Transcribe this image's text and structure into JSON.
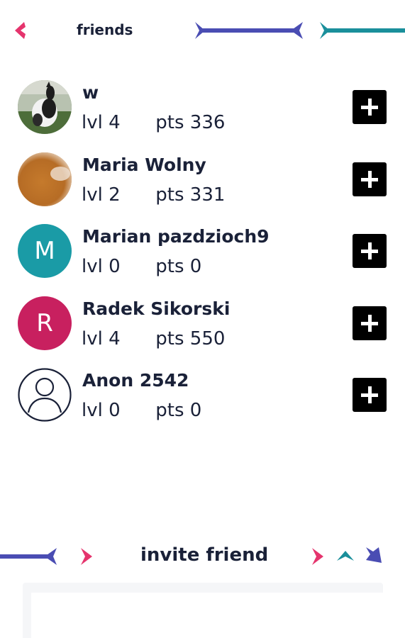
{
  "header": {
    "title": "friends",
    "back_icon": "chevron-left-icon"
  },
  "colors": {
    "accent_pink": "#e5346d",
    "accent_indigo": "#4a4db3",
    "accent_teal": "#1a8f9b",
    "text_dark": "#1a2138"
  },
  "friends": [
    {
      "name": "w",
      "level_label": "lvl 4",
      "points_label": "pts 336",
      "avatar": "photo-cat",
      "add_icon": "plus-icon"
    },
    {
      "name": "Maria Wolny",
      "level_label": "lvl 2",
      "points_label": "pts 331",
      "avatar": "photo-amber",
      "add_icon": "plus-icon"
    },
    {
      "name": "Marian pazdzioch9",
      "level_label": "lvl 0",
      "points_label": "pts 0",
      "avatar": "initial",
      "avatar_initial": "M",
      "avatar_color": "#1a9ba6",
      "add_icon": "plus-icon"
    },
    {
      "name": "Radek Sikorski",
      "level_label": "lvl 4",
      "points_label": "pts 550",
      "avatar": "initial",
      "avatar_initial": "R",
      "avatar_color": "#c8205f",
      "add_icon": "plus-icon"
    },
    {
      "name": "Anon 2542",
      "level_label": "lvl 0",
      "points_label": "pts 0",
      "avatar": "default-user",
      "add_icon": "plus-icon"
    }
  ],
  "footer": {
    "invite_label": "invite friend"
  }
}
